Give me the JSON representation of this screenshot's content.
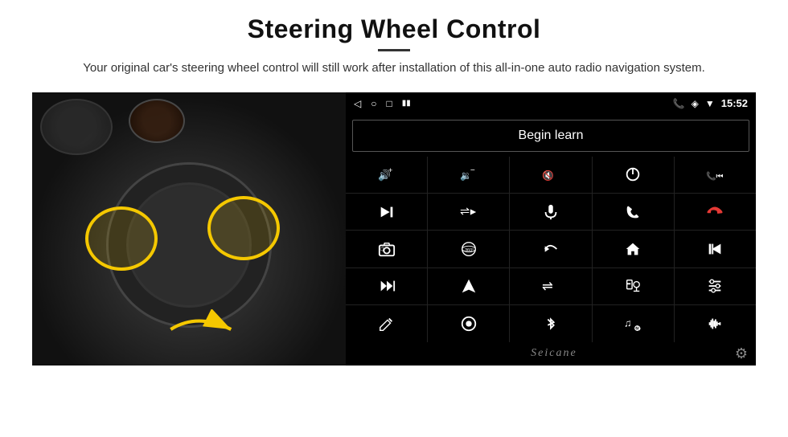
{
  "page": {
    "title": "Steering Wheel Control",
    "subtitle": "Your original car's steering wheel control will still work after installation of this all-in-one auto radio navigation system.",
    "divider": true
  },
  "status_bar": {
    "time": "15:52",
    "icons": [
      "back-arrow",
      "home-circle",
      "square",
      "signal-bars",
      "wifi",
      "phone",
      "location",
      "battery"
    ]
  },
  "begin_learn": {
    "label": "Begin learn"
  },
  "controls": {
    "rows": [
      [
        {
          "icon": "vol-up",
          "symbol": "🔊+"
        },
        {
          "icon": "vol-down",
          "symbol": "🔊−"
        },
        {
          "icon": "vol-mute",
          "symbol": "🔇"
        },
        {
          "icon": "power",
          "symbol": "⏻"
        },
        {
          "icon": "call-prev",
          "symbol": "📞⏮"
        }
      ],
      [
        {
          "icon": "next-track",
          "symbol": "⏭"
        },
        {
          "icon": "shuffle",
          "symbol": "⇌⏭"
        },
        {
          "icon": "mic",
          "symbol": "🎙"
        },
        {
          "icon": "phone",
          "symbol": "📞"
        },
        {
          "icon": "hang-up",
          "symbol": "📵"
        }
      ],
      [
        {
          "icon": "camera",
          "symbol": "📷"
        },
        {
          "icon": "360-view",
          "symbol": "360°"
        },
        {
          "icon": "back",
          "symbol": "↩"
        },
        {
          "icon": "home",
          "symbol": "⌂"
        },
        {
          "icon": "prev-track",
          "symbol": "⏮⏮"
        }
      ],
      [
        {
          "icon": "fast-forward",
          "symbol": "⏭⏭"
        },
        {
          "icon": "navigate",
          "symbol": "➤"
        },
        {
          "icon": "equalizer",
          "symbol": "⇌"
        },
        {
          "icon": "record",
          "symbol": "⏺"
        },
        {
          "icon": "settings-sliders",
          "symbol": "⧓"
        }
      ],
      [
        {
          "icon": "edit",
          "symbol": "✏"
        },
        {
          "icon": "circle-dot",
          "symbol": "⊙"
        },
        {
          "icon": "bluetooth",
          "symbol": "⚡"
        },
        {
          "icon": "music-settings",
          "symbol": "♫"
        },
        {
          "icon": "waveform",
          "symbol": "📊"
        }
      ]
    ]
  },
  "branding": {
    "name": "Seicane"
  }
}
